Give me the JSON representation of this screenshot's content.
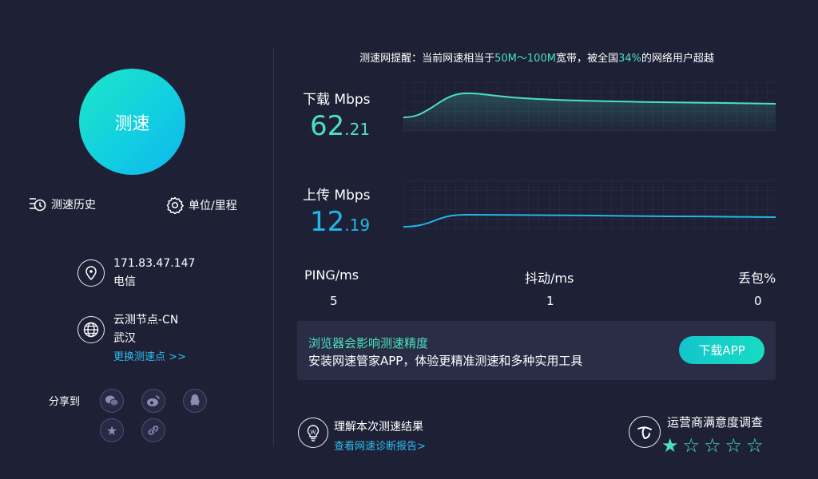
{
  "left": {
    "speed_button": "测速",
    "history_label": "测速历史",
    "unit_label": "单位/里程",
    "ip": "171.83.47.147",
    "isp": "电信",
    "node_name": "云测节点-CN",
    "node_city": "武汉",
    "change_node": "更换测速点 >>",
    "share_label": "分享到"
  },
  "notice": {
    "prefix": "测速网提醒：当前网速相当于",
    "band": "50M～100M",
    "middle": "宽带，被全国",
    "percent": "34%",
    "suffix": "的网络用户超越"
  },
  "download": {
    "label": "下载 Mbps",
    "int": "62",
    "dec": ".21"
  },
  "upload": {
    "label": "上传 Mbps",
    "int": "12",
    "dec": ".19"
  },
  "stats": [
    {
      "label": "PING/ms",
      "value": "5"
    },
    {
      "label": "抖动/ms",
      "value": "1"
    },
    {
      "label": "丢包%",
      "value": "0"
    }
  ],
  "promo": {
    "title": "浏览器会影响测速精度",
    "desc": "安装网速管家APP，体验更精准测速和多种实用工具",
    "button": "下载APP"
  },
  "result": {
    "title": "理解本次测速结果",
    "link": "查看网速诊断报告>"
  },
  "survey": {
    "title": "运营商满意度调查",
    "rating": 1,
    "max": 5
  },
  "colors": {
    "accent": "#4be0c0",
    "upload": "#1fb8e8",
    "link": "#2dbdf0",
    "background": "#1e2136"
  },
  "icons": [
    "history-icon",
    "gear-icon",
    "location-pin-icon",
    "globe-icon",
    "wechat-icon",
    "weibo-icon",
    "qq-icon",
    "favorite-icon",
    "link-icon",
    "lightbulb-icon",
    "telecom-logo-icon",
    "star-icon"
  ]
}
